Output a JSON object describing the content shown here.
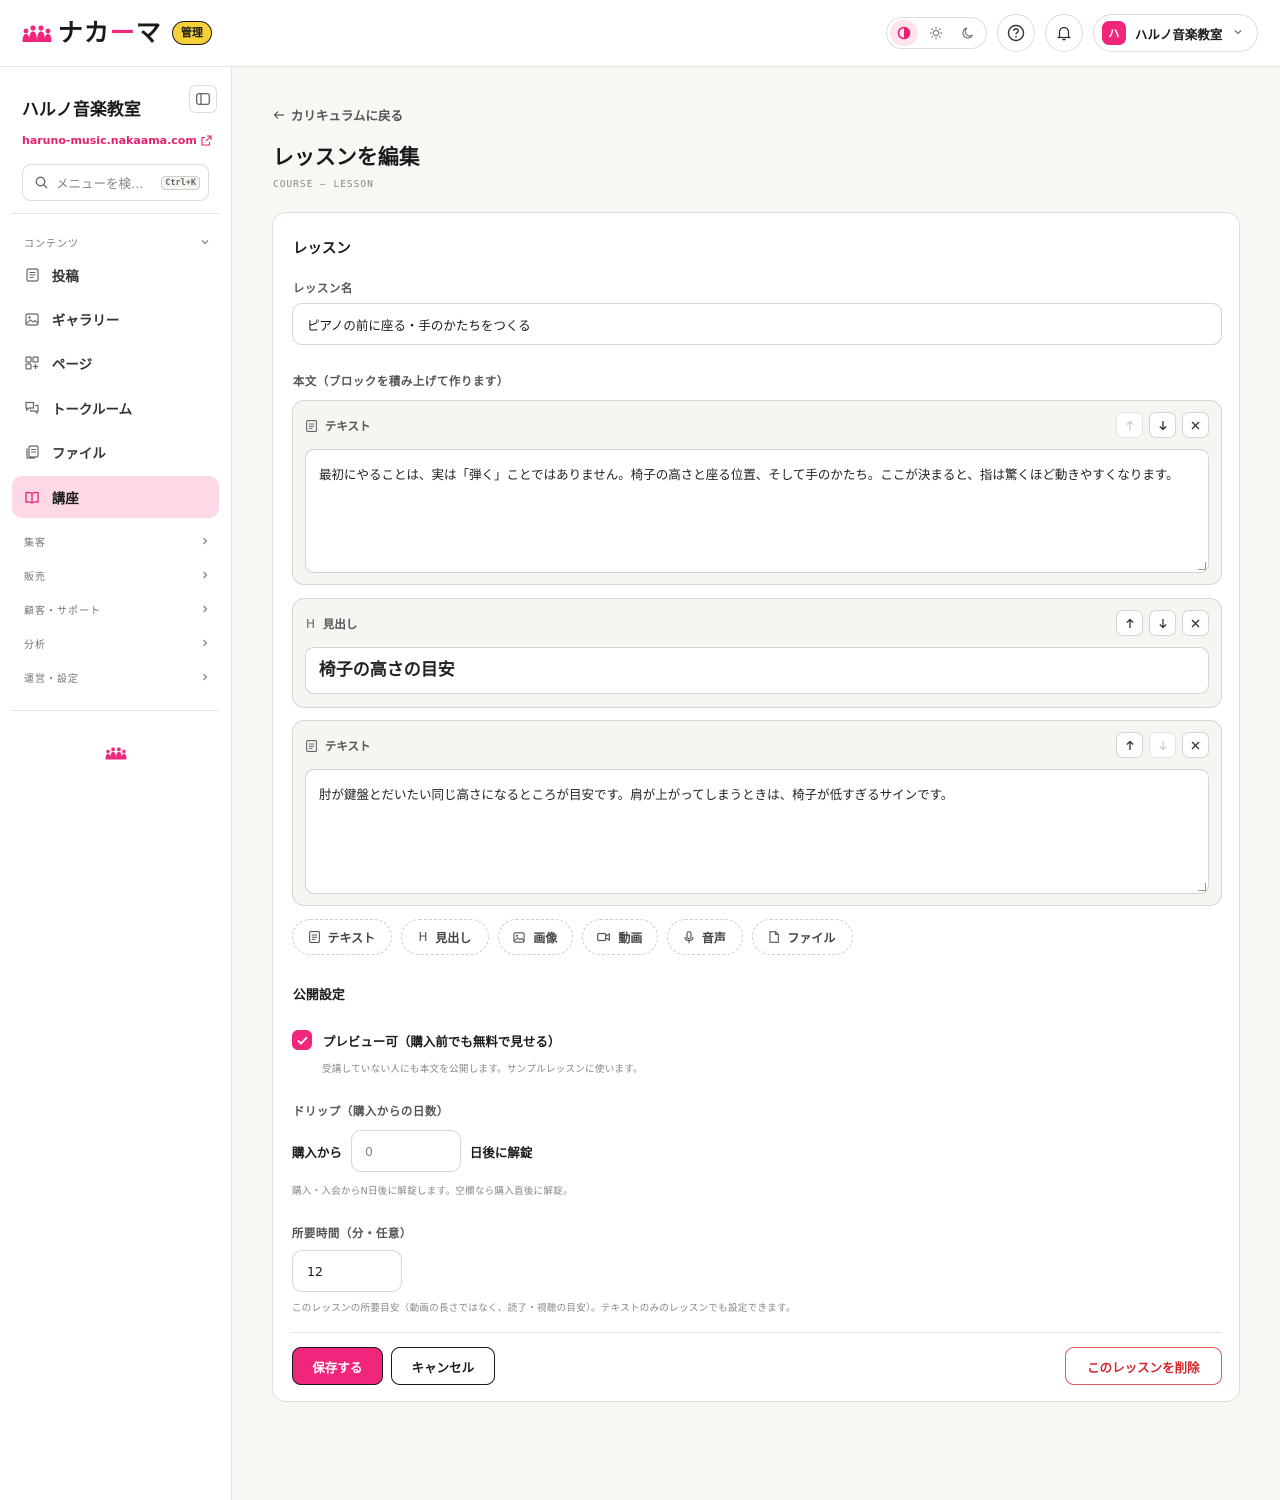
{
  "header": {
    "logo_text_1": "ナカ",
    "logo_text_dash": "ー",
    "logo_text_2": "マ",
    "admin_badge": "管理",
    "theme_modes": [
      "contrast-icon",
      "sun-icon",
      "moon-icon"
    ],
    "active_theme": "contrast",
    "account": {
      "avatar_text": "ハ",
      "name": "ハルノ音楽教室"
    }
  },
  "sidebar": {
    "site_name": "ハルノ音楽教室",
    "site_url": "haruno-music.nakaama.com",
    "search_placeholder": "メニューを検…",
    "search_shortcut": "Ctrl+K",
    "content_section": "コンテンツ",
    "items": [
      {
        "label": "投稿",
        "icon": "document-icon",
        "active": false
      },
      {
        "label": "ギャラリー",
        "icon": "image-icon",
        "active": false
      },
      {
        "label": "ページ",
        "icon": "pages-icon",
        "active": false
      },
      {
        "label": "トークルーム",
        "icon": "chat-icon",
        "active": false
      },
      {
        "label": "ファイル",
        "icon": "files-icon",
        "active": false
      },
      {
        "label": "講座",
        "icon": "book-icon",
        "active": true
      }
    ],
    "sections": [
      "集客",
      "販売",
      "顧客・サポート",
      "分析",
      "運営・設定"
    ]
  },
  "main": {
    "back_link": "カリキュラムに戻る",
    "title": "レッスンを編集",
    "subtitle": "COURSE — LESSON",
    "card_title": "レッスン",
    "lesson_name_label": "レッスン名",
    "lesson_name_value": "ピアノの前に座る・手のかたちをつくる",
    "body_label": "本文（ブロックを積み上げて作ります）",
    "blocks": [
      {
        "type": "テキスト",
        "icon": "text-icon",
        "content": "最初にやることは、実は「弾く」ことではありません。椅子の高さと座る位置、そして手のかたち。ここが決まると、指は驚くほど動きやすくなります。"
      },
      {
        "type": "見出し",
        "icon": "heading-icon",
        "content": "椅子の高さの目安"
      },
      {
        "type": "テキスト",
        "icon": "text-icon",
        "content": "肘が鍵盤とだいたい同じ高さになるところが目安です。肩が上がってしまうときは、椅子が低すぎるサインです。"
      }
    ],
    "add_buttons": [
      {
        "label": "テキスト",
        "icon": "text-icon"
      },
      {
        "label": "見出し",
        "icon": "heading-icon"
      },
      {
        "label": "画像",
        "icon": "image-icon"
      },
      {
        "label": "動画",
        "icon": "video-icon"
      },
      {
        "label": "音声",
        "icon": "mic-icon"
      },
      {
        "label": "ファイル",
        "icon": "file-icon"
      }
    ],
    "publish_title": "公開設定",
    "preview_label": "プレビュー可（購入前でも無料で見せる）",
    "preview_checked": true,
    "preview_help": "受講していない人にも本文を公開します。サンプルレッスンに使います。",
    "drip_label": "ドリップ（購入からの日数）",
    "drip_prefix": "購入から",
    "drip_value": "0",
    "drip_suffix": "日後に解錠",
    "drip_help": "購入・入会からN日後に解錠します。空欄なら購入直後に解錠。",
    "duration_label": "所要時間（分・任意）",
    "duration_value": "12",
    "duration_help": "このレッスンの所要目安（動画の長さではなく、読了・視聴の目安）。テキストのみのレッスンでも設定できます。",
    "save_button": "保存する",
    "cancel_button": "キャンセル",
    "delete_button": "このレッスンを削除"
  },
  "colors": {
    "accent": "#f0267c",
    "accent_soft": "#fdd9e7",
    "badge": "#f7d038",
    "danger": "#d6262c"
  }
}
